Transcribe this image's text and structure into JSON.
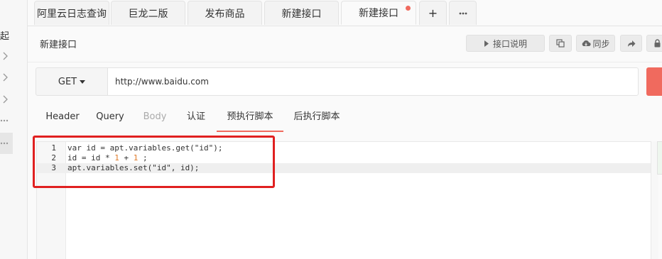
{
  "left_sidebar": {
    "partial_text": "起"
  },
  "tabs": [
    {
      "label": "阿里云日志查询"
    },
    {
      "label": "巨龙二版"
    },
    {
      "label": "发布商品"
    },
    {
      "label": "新建接口"
    },
    {
      "label": "新建接口",
      "active": true,
      "unsaved": true
    }
  ],
  "tab_actions": {
    "add": "+",
    "more": "···"
  },
  "titlebar": {
    "title": "新建接口",
    "doc_button": "接口说明",
    "sync_button": "同步"
  },
  "request": {
    "method": "GET",
    "url": "http://www.baidu.com"
  },
  "subtabs": [
    {
      "label": "Header"
    },
    {
      "label": "Query"
    },
    {
      "label": "Body",
      "disabled": true
    },
    {
      "label": "认证"
    },
    {
      "label": "预执行脚本",
      "active": true
    },
    {
      "label": "后执行脚本"
    }
  ],
  "editor": {
    "lines": [
      {
        "number": "1",
        "code": "var id = apt.variables.get(\"id\");"
      },
      {
        "number": "2",
        "code": "id = id * 1 + 1 ;"
      },
      {
        "number": "3",
        "code": "apt.variables.set(\"id\", id);"
      }
    ],
    "current_line": 3
  },
  "colors": {
    "accent": "#f06a5e",
    "highlight_box": "#e02020",
    "number_literal": "#e07b2a"
  },
  "icons": [
    "chevron-right-icon",
    "more-dots-icon",
    "caret-right-icon",
    "copy-icon",
    "cloud-sync-icon",
    "share-icon",
    "lock-icon",
    "caret-down-icon"
  ]
}
